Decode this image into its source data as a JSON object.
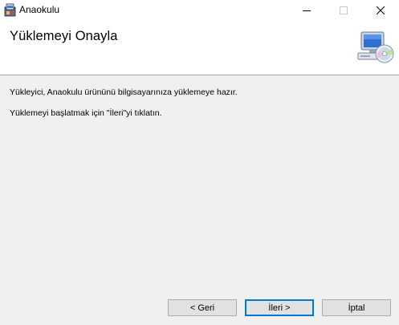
{
  "window": {
    "title": "Anaokulu",
    "controls": [
      "minimize-icon",
      "maximize-icon",
      "close-icon"
    ]
  },
  "header": {
    "title": "Yüklemeyi Onayla",
    "icon": "computer-with-disc-icon"
  },
  "content": {
    "line1": "Yükleyici, Anaokulu ürününü bilgisayarınıza yüklemeye hazır.",
    "line2": "Yüklemeyi başlatmak için \"İleri\"yi tıklatın."
  },
  "buttons": {
    "back": "< Geri",
    "next": "İleri >",
    "cancel": "İptal"
  },
  "colors": {
    "accent": "#0078d7",
    "background": "#f0f0f0",
    "header_bg": "#ffffff"
  }
}
